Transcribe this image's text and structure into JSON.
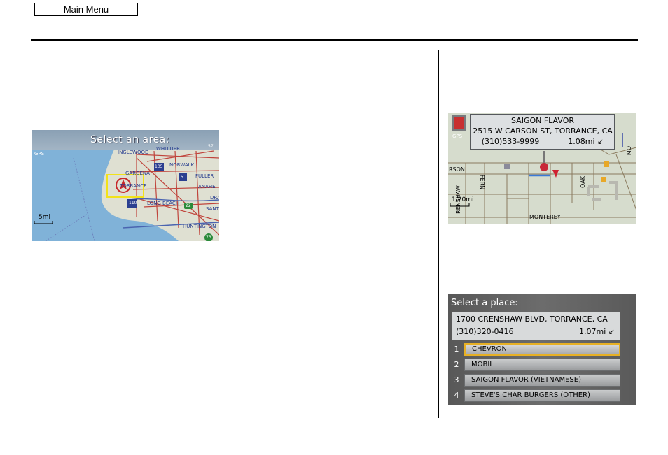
{
  "header": {
    "main_menu_label": "Main Menu"
  },
  "screen1": {
    "title": "Select an area:",
    "gps": "GPS",
    "scale": "5mi",
    "labels": [
      "INGLEWOOD",
      "WHITTIER",
      "NORWALK",
      "GARDENA",
      "FULLER",
      "TORRANCE",
      "ANAHE",
      "LONG BEACH",
      "DRA",
      "SANT",
      "HUNTINGTON"
    ],
    "shields": [
      "105",
      "5",
      "110",
      "22",
      "73",
      "57"
    ]
  },
  "screen2": {
    "place_name": "SAIGON FLAVOR",
    "address": "2515 W CARSON ST, TORRANCE, CA",
    "phone": "(310)533-9999",
    "distance": "1.08mi",
    "gps": "GPS",
    "scale": "1/20mi",
    "streets": [
      "RSON",
      "MONTEREY",
      "OAK",
      "FERN",
      "RENSHAW",
      "MO"
    ]
  },
  "screen3": {
    "title": "Select a place:",
    "address": "1700 CRENSHAW BLVD, TORRANCE, CA",
    "phone": "(310)320-0416",
    "distance": "1.07mi",
    "items": [
      {
        "num": "1",
        "label": "CHEVRON"
      },
      {
        "num": "2",
        "label": "MOBIL"
      },
      {
        "num": "3",
        "label": "SAIGON FLAVOR (VIETNAMESE)"
      },
      {
        "num": "4",
        "label": "STEVE'S CHAR BURGERS (OTHER)"
      }
    ]
  }
}
